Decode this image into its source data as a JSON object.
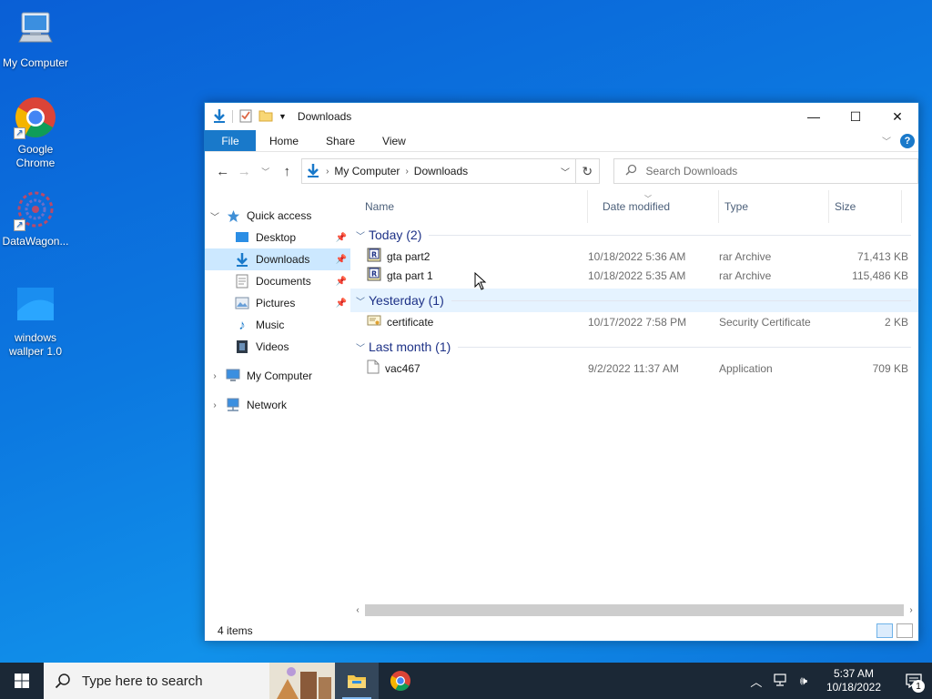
{
  "desktop": {
    "icons": [
      {
        "label": "My Computer",
        "icon": "computer-icon"
      },
      {
        "label": "Google Chrome",
        "icon": "chrome-icon"
      },
      {
        "label": "DataWagon...",
        "icon": "datawagon-icon"
      },
      {
        "label": "windows wallper 1.0",
        "icon": "wallpaper-app-icon"
      }
    ]
  },
  "window": {
    "title": "Downloads",
    "controls": {
      "minimize": "—",
      "maximize": "☐",
      "close": "✕"
    },
    "ribbon": {
      "file": "File",
      "tabs": [
        "Home",
        "Share",
        "View"
      ]
    },
    "address": {
      "crumbs": [
        "My Computer",
        "Downloads"
      ]
    },
    "search": {
      "placeholder": "Search Downloads"
    },
    "nav": {
      "quick_access": "Quick access",
      "items": [
        {
          "label": "Desktop",
          "pinned": true
        },
        {
          "label": "Downloads",
          "pinned": true,
          "selected": true
        },
        {
          "label": "Documents",
          "pinned": true
        },
        {
          "label": "Pictures",
          "pinned": true
        },
        {
          "label": "Music",
          "pinned": false
        },
        {
          "label": "Videos",
          "pinned": false
        }
      ],
      "my_computer": "My Computer",
      "network": "Network"
    },
    "columns": {
      "name": "Name",
      "date": "Date modified",
      "type": "Type",
      "size": "Size"
    },
    "groups": [
      {
        "label": "Today (2)",
        "files": [
          {
            "name": "gta part2",
            "date": "10/18/2022 5:36 AM",
            "type": "rar Archive",
            "size": "71,413 KB",
            "icon": "rar-icon"
          },
          {
            "name": "gta part 1",
            "date": "10/18/2022 5:35 AM",
            "type": "rar Archive",
            "size": "115,486 KB",
            "icon": "rar-icon"
          }
        ]
      },
      {
        "label": "Yesterday (1)",
        "files": [
          {
            "name": "certificate",
            "date": "10/17/2022 7:58 PM",
            "type": "Security Certificate",
            "size": "2 KB",
            "icon": "certificate-icon"
          }
        ]
      },
      {
        "label": "Last month (1)",
        "files": [
          {
            "name": "vac467",
            "date": "9/2/2022 11:37 AM",
            "type": "Application",
            "size": "709 KB",
            "icon": "application-icon"
          }
        ]
      }
    ],
    "status": "4 items"
  },
  "taskbar": {
    "search_placeholder": "Type here to search",
    "clock": {
      "time": "5:37 AM",
      "date": "10/18/2022"
    },
    "notification_count": "1"
  },
  "colors": {
    "accent": "#1979ca",
    "group_header": "#1e3287",
    "selection": "#cce8ff",
    "taskbar": "#1b2836"
  }
}
